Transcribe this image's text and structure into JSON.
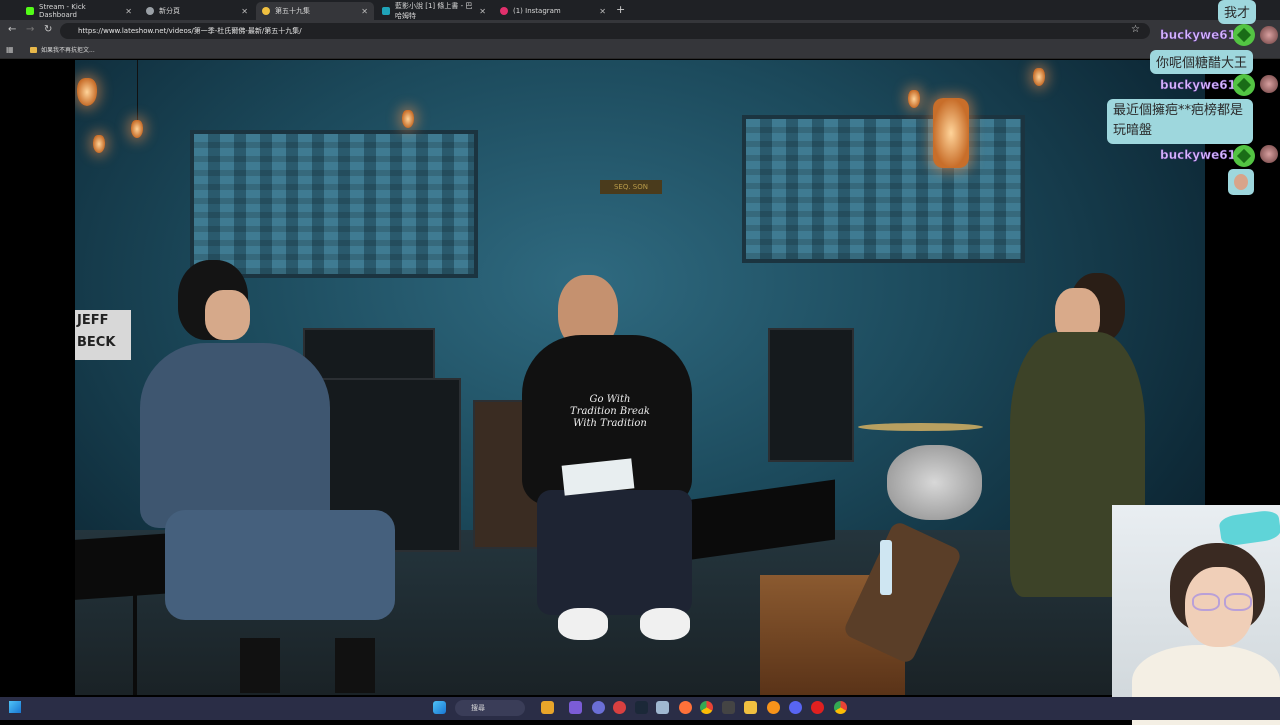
{
  "browser": {
    "tabs": [
      {
        "label": "Stream - Kick Dashboard",
        "favicon_color": "#53fc18"
      },
      {
        "label": "新分頁",
        "favicon_color": "#9aa0a6"
      },
      {
        "label": "第五十九集",
        "favicon_color": "#f0c040"
      },
      {
        "label": "藍影小說 [1] 條上書 - 巴哈姆特",
        "favicon_color": "#1fa3b8"
      },
      {
        "label": "(1) Instagram",
        "favicon_color": "#e1306c"
      }
    ],
    "url": "https://www.lateshow.net/videos/第一季-杜氏爾佛-最新/第五十九集/",
    "bookmark": "如果我不再抗拒文..."
  },
  "video": {
    "shirt_text": "Go With Tradition Break With Tradition",
    "jeff_sign": "JEFF BECK",
    "bar_sign": "SEQ. SON"
  },
  "chat": {
    "messages": [
      {
        "text": "我才"
      },
      {
        "user": "buckywe615"
      },
      {
        "text": "你呢個糖醋大王"
      },
      {
        "user": "buckywe615"
      },
      {
        "text": "最近個擁疤**疤榜都是玩暗盤"
      },
      {
        "user": "buckywe615"
      }
    ]
  },
  "taskbar": {
    "search_label": "搜尋"
  }
}
